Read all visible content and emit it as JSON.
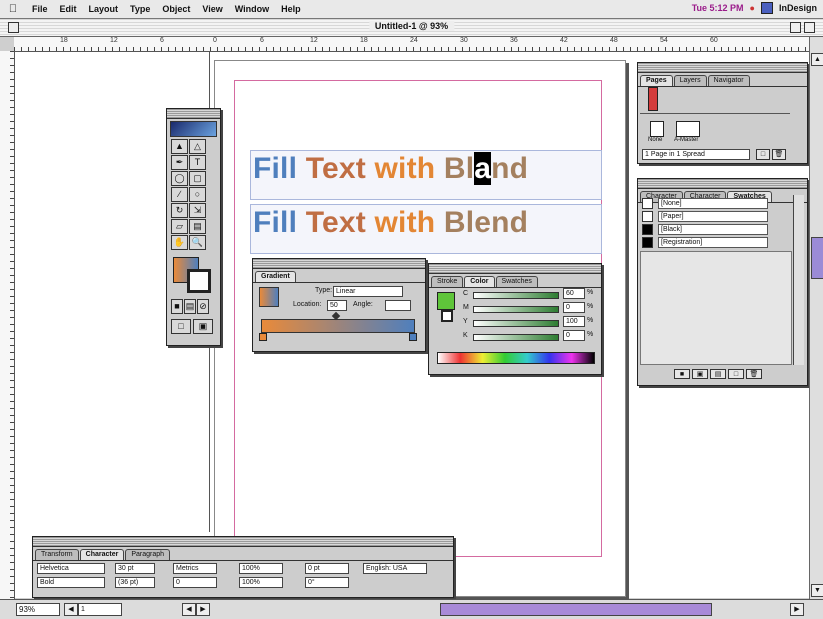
{
  "menubar": {
    "apple": "",
    "items": [
      "File",
      "Edit",
      "Layout",
      "Type",
      "Object",
      "View",
      "Window",
      "Help"
    ],
    "time": "Tue 5:12 PM",
    "app_name": "InDesign"
  },
  "window": {
    "title": "Untitled-1 @ 93%"
  },
  "ruler": {
    "labels": [
      "18",
      "12",
      "6",
      "0",
      "6",
      "12",
      "18",
      "24",
      "30",
      "36",
      "42",
      "48",
      "54",
      "60"
    ]
  },
  "document": {
    "headline_1": {
      "w1": "Fill",
      "w2": "Text",
      "w3": "with",
      "w4a": "Bl",
      "w4sel": "a",
      "w4b": "nd"
    },
    "headline_2": {
      "w1": "Fill",
      "w2": "Text",
      "w3": "with",
      "w4": "Blend"
    }
  },
  "gradient_palette": {
    "tab": "Gradient",
    "type_label": "Type:",
    "type_value": "Linear",
    "location_label": "Location:",
    "location_value": "50",
    "angle_label": "Angle:",
    "angle_value": "",
    "colors": {
      "left": "#e98a3a",
      "right": "#4f7fbd"
    }
  },
  "color_palette": {
    "tabs": [
      "Stroke",
      "Color",
      "Swatches"
    ],
    "rows": [
      {
        "label": "C",
        "value": "60"
      },
      {
        "label": "M",
        "value": "0"
      },
      {
        "label": "Y",
        "value": "100"
      },
      {
        "label": "K",
        "value": "0"
      }
    ],
    "unit": "%"
  },
  "pages_palette": {
    "tabs": [
      "Pages",
      "Layers",
      "Navigator"
    ],
    "master_label": "None",
    "master_label_2": "A-Master",
    "footer": "1 Page in 1 Spread"
  },
  "swatches_palette": {
    "tabs": [
      "Character",
      "Character",
      "Swatches"
    ],
    "items": [
      {
        "name": "[None]",
        "color": "#ffffff"
      },
      {
        "name": "[Paper]",
        "color": "#ffffff"
      },
      {
        "name": "[Black]",
        "color": "#000000"
      },
      {
        "name": "[Registration]",
        "color": "#000000"
      }
    ]
  },
  "character_palette": {
    "tabs": [
      "Transform",
      "Character",
      "Paragraph"
    ],
    "font_value": "Helvetica",
    "style_value": "Bold",
    "size_value": "30 pt",
    "leading_value": "(36 pt)",
    "kerning_label": "Metrics",
    "tracking_value": "0",
    "vscale_value": "100%",
    "hscale_value": "100%",
    "baseline_value": "0 pt",
    "skew_value": "0°",
    "language_value": "English: USA"
  },
  "statusbar": {
    "zoom": "93%",
    "page": "1"
  }
}
